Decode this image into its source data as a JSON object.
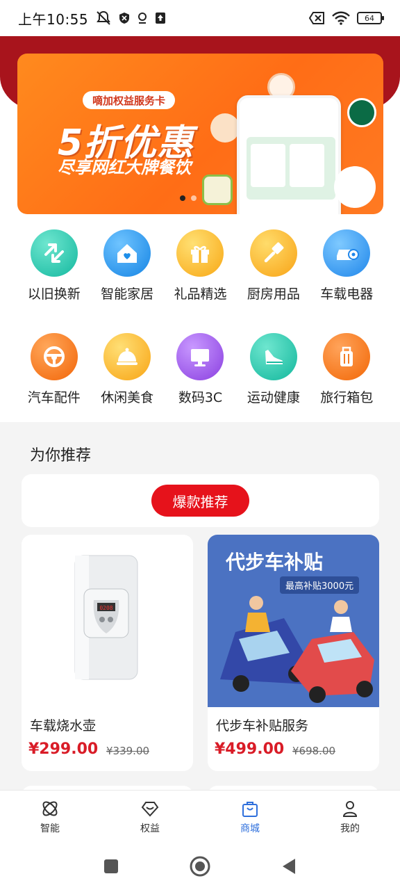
{
  "status_bar": {
    "time": "上午10:55",
    "battery": "64"
  },
  "banner": {
    "tag": "嘀加权益服务卡",
    "title": "5折优惠",
    "subtitle": "尽享网红大牌餐饮"
  },
  "categories": [
    {
      "label": "以旧换新",
      "icon": "exchange-arrows-icon",
      "color": "#28cbb4"
    },
    {
      "label": "智能家居",
      "icon": "smart-home-icon",
      "color": "#2c9ff0"
    },
    {
      "label": "礼品精选",
      "icon": "gift-icon",
      "color": "#fbb624"
    },
    {
      "label": "厨房用品",
      "icon": "spatula-icon",
      "color": "#fcb12a"
    },
    {
      "label": "车载电器",
      "icon": "car-fan-icon",
      "color": "#3b9cf2"
    },
    {
      "label": "汽车配件",
      "icon": "steering-wheel-icon",
      "color": "#fd7a1a"
    },
    {
      "label": "休闲美食",
      "icon": "food-cloche-icon",
      "color": "#fcb22b"
    },
    {
      "label": "数码3C",
      "icon": "monitor-icon",
      "color": "#a05ae6"
    },
    {
      "label": "运动健康",
      "icon": "sneaker-icon",
      "color": "#27c6b2"
    },
    {
      "label": "旅行箱包",
      "icon": "suitcase-icon",
      "color": "#fd7a1d"
    }
  ],
  "recommend": {
    "title": "为你推荐",
    "hot_button": "爆款推荐"
  },
  "products": [
    {
      "name": "车载烧水壶",
      "price": "¥299.00",
      "old_price": "¥339.00"
    },
    {
      "name": "代步车补贴服务",
      "price": "¥499.00",
      "old_price": "¥698.00",
      "image_title": "代步车补贴",
      "image_badge": "最高补贴3000元"
    }
  ],
  "bottom_nav": [
    {
      "label": "智能",
      "icon": "atom-icon",
      "active": false
    },
    {
      "label": "权益",
      "icon": "heart-badge-icon",
      "active": false
    },
    {
      "label": "商城",
      "icon": "shopping-bag-icon",
      "active": true
    },
    {
      "label": "我的",
      "icon": "person-icon",
      "active": false
    }
  ],
  "colors": {
    "accent_red": "#e6121b",
    "active_blue": "#2e6fdc",
    "header_red": "#a8141c"
  }
}
